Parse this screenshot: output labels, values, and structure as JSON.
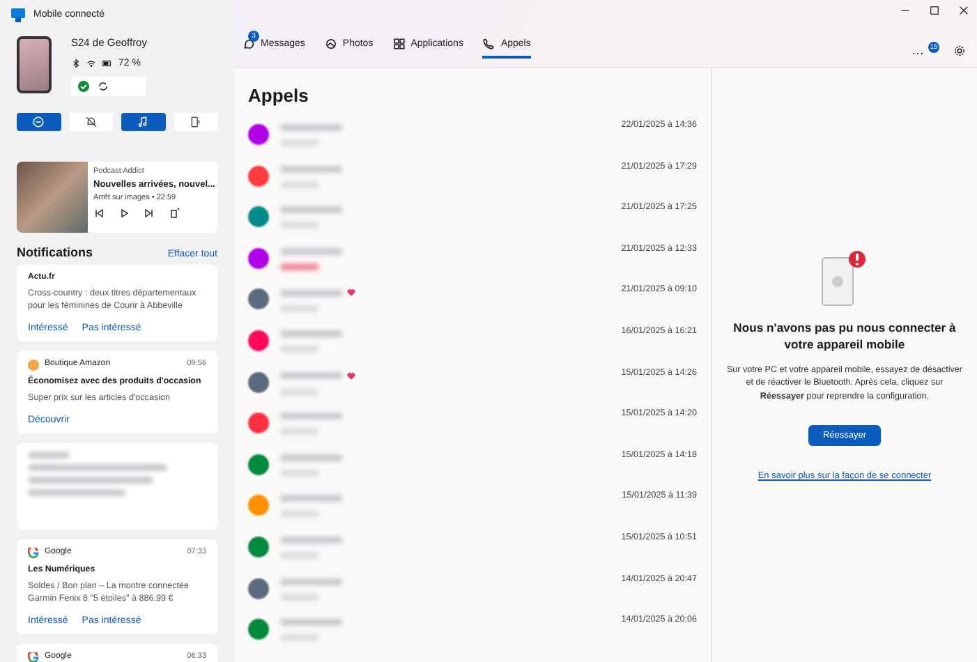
{
  "window": {
    "title": "Mobile connecté"
  },
  "device": {
    "name": "S24 de Geoffroy",
    "battery": "72 %",
    "connected": true
  },
  "quick_actions": [
    {
      "kind": "dnd",
      "selected": true
    },
    {
      "kind": "mute",
      "selected": false
    },
    {
      "kind": "music",
      "selected": true
    },
    {
      "kind": "audio",
      "selected": false
    }
  ],
  "media": {
    "app": "Podcast Addict",
    "title": "Nouvelles arrivées, nouvel...",
    "subtitle": "Arrêt sur images • 22:59"
  },
  "notifications": {
    "title": "Notifications",
    "clear": "Effacer tout",
    "items": [
      {
        "kind": "plain",
        "app": "Actu.fr",
        "body": "Cross-country : deux titres départementaux pour les féminines de Courir à Abbeville",
        "actions": [
          "Intéressé",
          "Pas intéressé"
        ]
      },
      {
        "kind": "shop",
        "app": "Boutique Amazon",
        "time": "09:56",
        "title": "Économisez avec des produits d'occasion",
        "body": "Super prix sur les articles d'occasion",
        "actions": [
          "Découvrir"
        ]
      },
      {
        "kind": "blurred"
      },
      {
        "kind": "google",
        "app": "Google",
        "time": "07:33",
        "title": "Les Numériques",
        "body": "Soldes / Bon plan – La montre connectée Garmin Fenix 8 \"5 étoiles\" à 886.99 €",
        "actions": [
          "Intéressé",
          "Pas intéressé"
        ]
      },
      {
        "kind": "google",
        "app": "Google",
        "time": "06:33"
      }
    ]
  },
  "tabs": [
    {
      "label": "Messages",
      "badge": "3",
      "selected": false
    },
    {
      "label": "Photos",
      "selected": false
    },
    {
      "label": "Applications",
      "selected": false
    },
    {
      "label": "Appels",
      "selected": true
    }
  ],
  "more": {
    "label": "…",
    "badge": "15"
  },
  "calls": {
    "title": "Appels",
    "rows": [
      {
        "color": "#b000e8",
        "date": "22/01/2025 à 14:36",
        "missed": false,
        "favorite": false
      },
      {
        "color": "#ff3b3b",
        "date": "21/01/2025 à 17:29",
        "missed": false,
        "favorite": false
      },
      {
        "color": "#008a8a",
        "date": "21/01/2025 à 17:25",
        "missed": false,
        "favorite": false
      },
      {
        "color": "#b000e8",
        "date": "21/01/2025 à 12:33",
        "missed": true,
        "favorite": false
      },
      {
        "color": "#5a6b80",
        "date": "21/01/2025 à 09:10",
        "missed": false,
        "favorite": true
      },
      {
        "color": "#ff0a5a",
        "date": "16/01/2025 à 16:21",
        "missed": false,
        "favorite": false
      },
      {
        "color": "#5a6b80",
        "date": "15/01/2025 à 14:26",
        "missed": false,
        "favorite": true
      },
      {
        "color": "#ff3040",
        "date": "15/01/2025 à 14:20",
        "missed": false,
        "favorite": false
      },
      {
        "color": "#008a3e",
        "date": "15/01/2025 à 14:18",
        "missed": false,
        "favorite": false
      },
      {
        "color": "#ff9000",
        "date": "15/01/2025 à 11:39",
        "missed": false,
        "favorite": false
      },
      {
        "color": "#008a3e",
        "date": "15/01/2025 à 10:51",
        "missed": false,
        "favorite": false
      },
      {
        "color": "#5a6b80",
        "date": "14/01/2025 à 20:47",
        "missed": false,
        "favorite": false
      },
      {
        "color": "#008a3e",
        "date": "14/01/2025 à 20:06",
        "missed": false,
        "favorite": false
      }
    ]
  },
  "error": {
    "title": "Nous n'avons pas pu nous connecter à votre appareil mobile",
    "body": "Sur votre PC et votre appareil mobile, essayez de désactiver et de réactiver le Bluetooth. Après cela, cliquez sur **Réessayer** pour reprendre la configuration.",
    "button": "Réessayer",
    "link": "En savoir plus sur la façon de se connecter"
  }
}
